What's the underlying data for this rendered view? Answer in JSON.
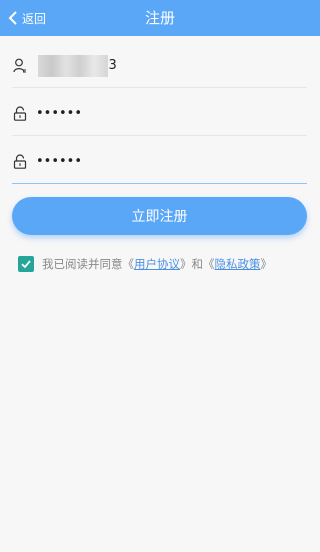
{
  "header": {
    "back_label": "返回",
    "title": "注册"
  },
  "form": {
    "phone": {
      "value": "93",
      "visible_suffix": "093",
      "icon": "user-icon"
    },
    "password": {
      "value": "••••••",
      "icon": "lock-icon"
    },
    "confirm_password": {
      "value": "••••••",
      "icon": "lock-icon"
    }
  },
  "submit_label": "立即注册",
  "agreement": {
    "checked": true,
    "prefix": "我已阅读并同意《",
    "terms_link": "用户协议",
    "middle": "》和《",
    "privacy_link": "隐私政策",
    "suffix": "》"
  },
  "colors": {
    "primary": "#5aa7f7",
    "checkbox": "#26a69a",
    "link": "#4a90e2"
  }
}
